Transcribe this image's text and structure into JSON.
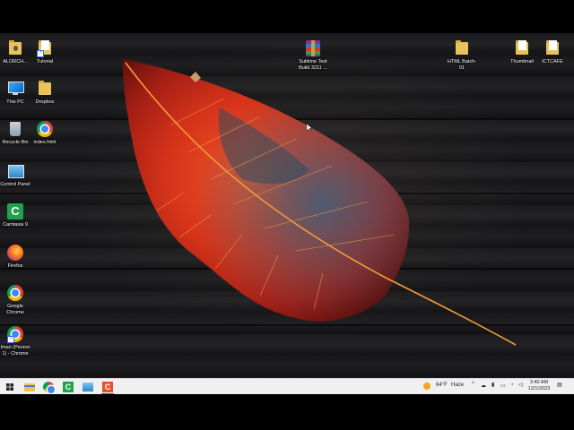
{
  "desktop": {
    "icons_left": [
      {
        "label": "ALORCH...",
        "icon": "user-folder-icon"
      },
      {
        "label": "Tutorial",
        "icon": "folder-shortcut-icon"
      },
      {
        "label": "This PC",
        "icon": "this-pc-icon"
      },
      {
        "label": "Dropbox",
        "icon": "dropbox-folder-icon"
      },
      {
        "label": "Recycle Bin",
        "icon": "recycle-bin-icon"
      },
      {
        "label": "index.html",
        "icon": "chrome-icon"
      },
      {
        "label": "Control Panel",
        "icon": "control-panel-icon"
      },
      {
        "label": "Camtasia 9",
        "icon": "camtasia-icon"
      },
      {
        "label": "Firefox",
        "icon": "firefox-icon"
      },
      {
        "label": "Google Chrome",
        "icon": "chrome-icon"
      },
      {
        "label": "Iman (Person 1) - Chrome",
        "icon": "chrome-profile-icon"
      }
    ],
    "icons_top": [
      {
        "label": "Sublime Text Build 3211 ...",
        "icon": "winrar-icon"
      },
      {
        "label": "HTML Batch-01",
        "icon": "folder-icon"
      },
      {
        "label": "Thumbnail",
        "icon": "folder-icon"
      },
      {
        "label": "ICTCAFE",
        "icon": "folder-icon"
      }
    ]
  },
  "taskbar": {
    "weather_temp": "64°F",
    "weather_text": "Haze",
    "time": "3:40 AM",
    "date": "12/1/2023",
    "accent": "#0078d4"
  }
}
